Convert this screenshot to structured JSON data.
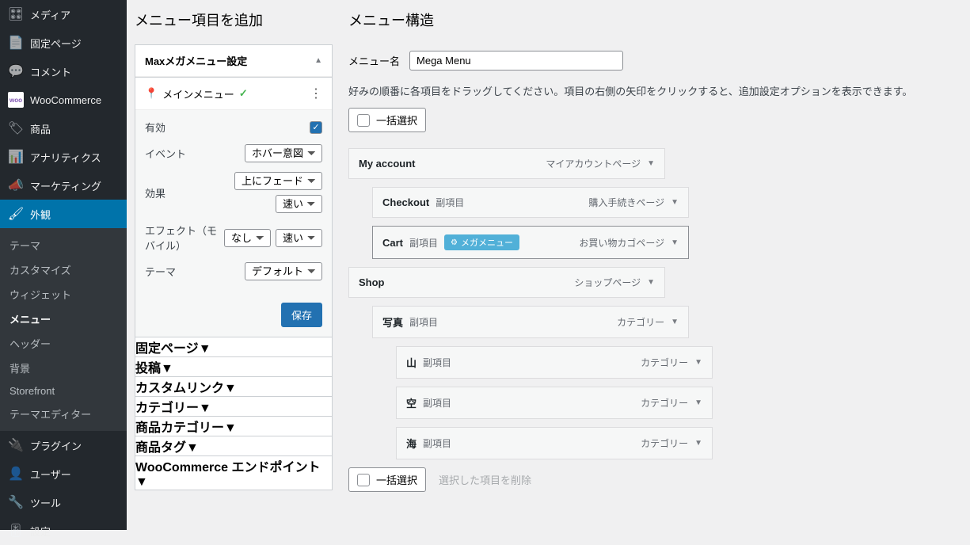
{
  "sidebar": {
    "items": [
      {
        "icon": "🖼",
        "label": "メディア"
      },
      {
        "icon": "📄",
        "label": "固定ページ"
      },
      {
        "icon": "💬",
        "label": "コメント"
      },
      {
        "icon": "woo",
        "label": "WooCommerce"
      },
      {
        "icon": "📦",
        "label": "商品"
      },
      {
        "icon": "📊",
        "label": "アナリティクス"
      },
      {
        "icon": "📣",
        "label": "マーケティング"
      },
      {
        "icon": "🖌",
        "label": "外観"
      },
      {
        "icon": "🔌",
        "label": "プラグイン"
      },
      {
        "icon": "👤",
        "label": "ユーザー"
      },
      {
        "icon": "🔧",
        "label": "ツール"
      },
      {
        "icon": "⚙",
        "label": "設定"
      }
    ],
    "submenu": [
      "テーマ",
      "カスタマイズ",
      "ウィジェット",
      "メニュー",
      "ヘッダー",
      "背景",
      "Storefront",
      "テーマエディター"
    ]
  },
  "left": {
    "title": "メニュー項目を追加",
    "mm_title": "Maxメガメニュー設定",
    "loc_label": "メインメニュー",
    "rows": {
      "enabled": "有効",
      "event": "イベント",
      "event_val": "ホバー意図",
      "effect": "効果",
      "effect_val1": "上にフェード",
      "effect_val2": "速い",
      "mobile": "エフェクト（モバイル）",
      "mobile_val1": "なし",
      "mobile_val2": "速い",
      "theme": "テーマ",
      "theme_val": "デフォルト"
    },
    "save": "保存",
    "accordions": [
      "固定ページ",
      "投稿",
      "カスタムリンク",
      "カテゴリー",
      "商品カテゴリー",
      "商品タグ",
      "WooCommerce エンドポイント"
    ]
  },
  "right": {
    "title": "メニュー構造",
    "name_label": "メニュー名",
    "name_value": "Mega Menu",
    "desc": "好みの順番に各項目をドラッグしてください。項目の右側の矢印をクリックすると、追加設定オプションを表示できます。",
    "bulk": "一括選択",
    "mega_label": "メガメニュー",
    "items": [
      {
        "title": "My account",
        "type": "マイアカウントページ",
        "depth": 0
      },
      {
        "title": "Checkout",
        "sub": "副項目",
        "type": "購入手続きページ",
        "depth": 1
      },
      {
        "title": "Cart",
        "sub": "副項目",
        "type": "お買い物カゴページ",
        "depth": 1,
        "mega": true,
        "selected": true
      },
      {
        "title": "Shop",
        "type": "ショップページ",
        "depth": 0
      },
      {
        "title": "写真",
        "sub": "副項目",
        "type": "カテゴリー",
        "depth": 1
      },
      {
        "title": "山",
        "sub": "副項目",
        "type": "カテゴリー",
        "depth": 2
      },
      {
        "title": "空",
        "sub": "副項目",
        "type": "カテゴリー",
        "depth": 2
      },
      {
        "title": "海",
        "sub": "副項目",
        "type": "カテゴリー",
        "depth": 2
      }
    ],
    "delete_selected": "選択した項目を削除"
  }
}
